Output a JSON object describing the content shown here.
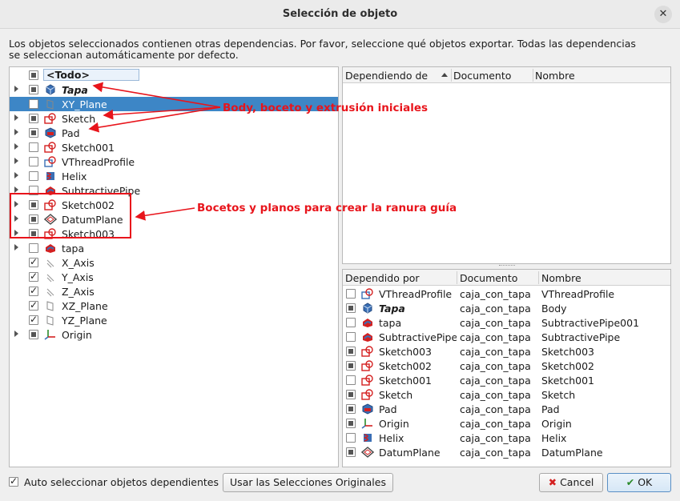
{
  "window": {
    "title": "Selección de objeto",
    "close_symbol": "✕"
  },
  "description": "Los objetos seleccionados contienen otras dependencias. Por favor, seleccione qué objetos exportar. Todas las dependencias se seleccionan automáticamente por defecto.",
  "tree": {
    "items": [
      {
        "label": "<Todo>",
        "check": "partial",
        "icon": "",
        "expandable": false,
        "style": "todo"
      },
      {
        "label": "Tapa",
        "check": "partial",
        "icon": "body-icon",
        "expandable": true,
        "style": "bi"
      },
      {
        "label": "XY_Plane",
        "check": "unchecked",
        "icon": "plane-icon",
        "expandable": false,
        "style": "selected"
      },
      {
        "label": "Sketch",
        "check": "partial",
        "icon": "sketch-icon",
        "expandable": true,
        "style": ""
      },
      {
        "label": "Pad",
        "check": "partial",
        "icon": "pad-icon",
        "expandable": true,
        "style": ""
      },
      {
        "label": "Sketch001",
        "check": "unchecked",
        "icon": "sketch-icon",
        "expandable": true,
        "style": ""
      },
      {
        "label": "VThreadProfile",
        "check": "unchecked",
        "icon": "vthread-icon",
        "expandable": true,
        "style": ""
      },
      {
        "label": "Helix",
        "check": "unchecked",
        "icon": "helix-icon",
        "expandable": true,
        "style": ""
      },
      {
        "label": "SubtractivePipe",
        "check": "unchecked",
        "icon": "subtractive-pipe-icon",
        "expandable": true,
        "style": ""
      },
      {
        "label": "Sketch002",
        "check": "partial",
        "icon": "sketch-icon",
        "expandable": true,
        "style": ""
      },
      {
        "label": "DatumPlane",
        "check": "partial",
        "icon": "datum-plane-icon",
        "expandable": true,
        "style": ""
      },
      {
        "label": "Sketch003",
        "check": "partial",
        "icon": "sketch-icon",
        "expandable": true,
        "style": ""
      },
      {
        "label": "tapa",
        "check": "unchecked",
        "icon": "subtractive-pipe-icon",
        "expandable": true,
        "style": ""
      },
      {
        "label": "X_Axis",
        "check": "checked",
        "icon": "axis-icon",
        "expandable": false,
        "style": ""
      },
      {
        "label": "Y_Axis",
        "check": "checked",
        "icon": "axis-icon",
        "expandable": false,
        "style": ""
      },
      {
        "label": "Z_Axis",
        "check": "checked",
        "icon": "axis-icon",
        "expandable": false,
        "style": ""
      },
      {
        "label": "XZ_Plane",
        "check": "checked",
        "icon": "plane-icon",
        "expandable": false,
        "style": ""
      },
      {
        "label": "YZ_Plane",
        "check": "checked",
        "icon": "plane-icon",
        "expandable": false,
        "style": ""
      },
      {
        "label": "Origin",
        "check": "partial",
        "icon": "origin-icon",
        "expandable": true,
        "style": ""
      }
    ]
  },
  "depending_on": {
    "columns": [
      "Dependiendo de",
      "Documento",
      "Nombre"
    ],
    "rows": []
  },
  "depended_by": {
    "columns": [
      "Dependido por",
      "Documento",
      "Nombre"
    ],
    "rows": [
      {
        "label": "VThreadProfile",
        "check": "unchecked",
        "icon": "vthread-icon",
        "doc": "caja_con_tapa",
        "name": "VThreadProfile",
        "style": ""
      },
      {
        "label": "Tapa",
        "check": "partial",
        "icon": "body-icon",
        "doc": "caja_con_tapa",
        "name": "Body",
        "style": "bi"
      },
      {
        "label": "tapa",
        "check": "unchecked",
        "icon": "subtractive-pipe-icon",
        "doc": "caja_con_tapa",
        "name": "SubtractivePipe001",
        "style": ""
      },
      {
        "label": "SubtractivePipe",
        "check": "unchecked",
        "icon": "subtractive-pipe-icon",
        "doc": "caja_con_tapa",
        "name": "SubtractivePipe",
        "style": ""
      },
      {
        "label": "Sketch003",
        "check": "partial",
        "icon": "sketch-icon",
        "doc": "caja_con_tapa",
        "name": "Sketch003",
        "style": ""
      },
      {
        "label": "Sketch002",
        "check": "partial",
        "icon": "sketch-icon",
        "doc": "caja_con_tapa",
        "name": "Sketch002",
        "style": ""
      },
      {
        "label": "Sketch001",
        "check": "unchecked",
        "icon": "sketch-icon",
        "doc": "caja_con_tapa",
        "name": "Sketch001",
        "style": ""
      },
      {
        "label": "Sketch",
        "check": "partial",
        "icon": "sketch-icon",
        "doc": "caja_con_tapa",
        "name": "Sketch",
        "style": ""
      },
      {
        "label": "Pad",
        "check": "partial",
        "icon": "pad-icon",
        "doc": "caja_con_tapa",
        "name": "Pad",
        "style": ""
      },
      {
        "label": "Origin",
        "check": "partial",
        "icon": "origin-icon",
        "doc": "caja_con_tapa",
        "name": "Origin",
        "style": ""
      },
      {
        "label": "Helix",
        "check": "unchecked",
        "icon": "helix-icon",
        "doc": "caja_con_tapa",
        "name": "Helix",
        "style": ""
      },
      {
        "label": "DatumPlane",
        "check": "partial",
        "icon": "datum-plane-icon",
        "doc": "caja_con_tapa",
        "name": "DatumPlane",
        "style": ""
      }
    ]
  },
  "annotations": {
    "first": "Body, boceto y extrusión iniciales",
    "second": "Bocetos y planos para crear la ranura guía",
    "color": "#e8141b"
  },
  "footer": {
    "auto_select_label": "Auto seleccionar objetos dependientes",
    "auto_select_checked": true,
    "use_original_button": "Usar las Selecciones Originales",
    "cancel_button": "Cancel",
    "ok_button": "OK"
  },
  "colors": {
    "selection": "#3d86c6",
    "sketch_red": "#d42020",
    "body_blue": "#3a6fb5"
  }
}
